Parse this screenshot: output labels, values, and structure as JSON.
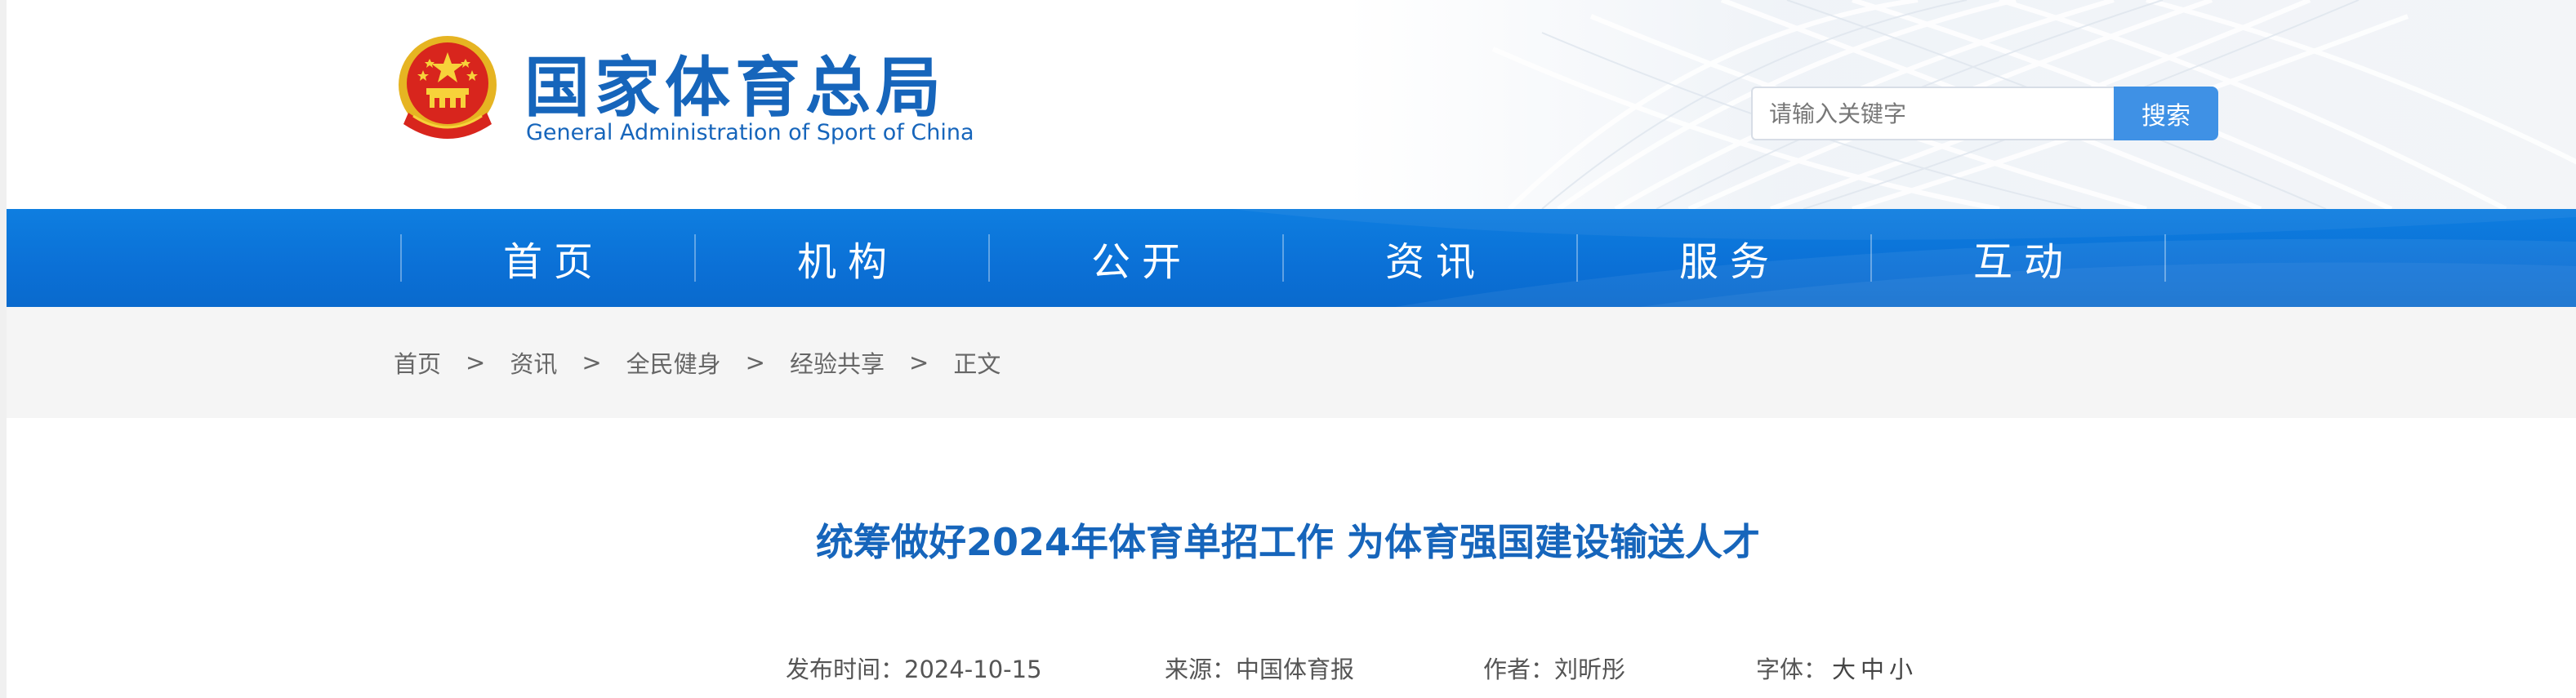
{
  "header": {
    "org_name_cn": "国家体育总局",
    "org_name_en": "General Administration of Sport of China",
    "emblem_icon": "national-emblem-icon",
    "search": {
      "placeholder": "请输入关键字",
      "button_label": "搜索"
    }
  },
  "nav": {
    "items": [
      {
        "label": "首页"
      },
      {
        "label": "机构"
      },
      {
        "label": "公开"
      },
      {
        "label": "资讯"
      },
      {
        "label": "服务"
      },
      {
        "label": "互动"
      }
    ]
  },
  "breadcrumb": {
    "items": [
      {
        "label": "首页"
      },
      {
        "label": "资讯"
      },
      {
        "label": "全民健身"
      },
      {
        "label": "经验共享"
      }
    ],
    "current": "正文",
    "separator": ">"
  },
  "article": {
    "title": "统筹做好2024年体育单招工作 为体育强国建设输送人才",
    "meta": {
      "date": "发布时间：2024-10-15",
      "source": "来源：中国体育报",
      "author": "作者：刘昕彤",
      "font_label": "字体：",
      "font_sizes": [
        "大",
        "中",
        "小"
      ]
    }
  },
  "colors": {
    "brand_blue": "#1665bb",
    "nav_blue": "#0b70d6",
    "search_button": "#3f91e5",
    "breadcrumb_bg": "#f5f5f5"
  }
}
